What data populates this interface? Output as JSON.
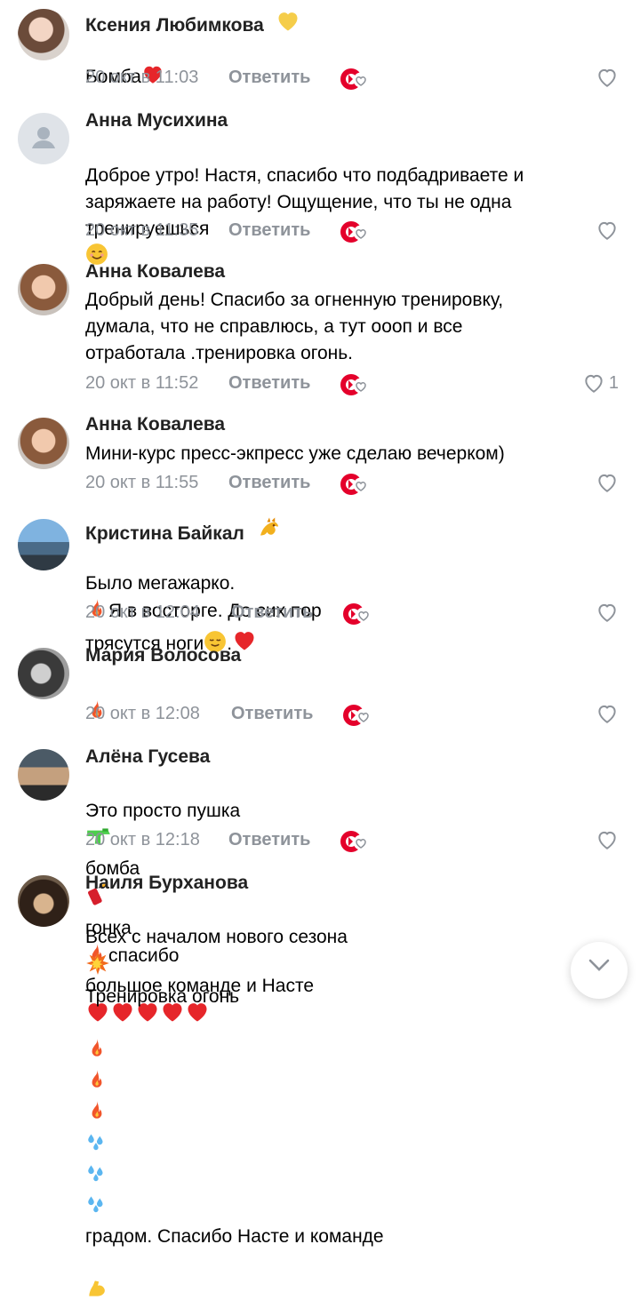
{
  "reply_label": "Ответить",
  "comments": [
    {
      "name": "Ксения Любимкова",
      "text": "Бомба",
      "time": "20 окт в 11:03"
    },
    {
      "name": "Анна Мусихина",
      "text": "Доброе утро! Настя, спасибо что подбадриваете и\nзаряжаете на работу! Ощущение, что ты не одна\nтренируешься",
      "time": "20 окт в 11:35"
    },
    {
      "name": "Анна Ковалева",
      "text": "Добрый день! Спасибо за огненную тренировку,\nдумала, что не справлюсь, а тут оооп и все\nотработала .тренировка огонь.",
      "time": "20 окт в 11:52",
      "likes": "1"
    },
    {
      "name": "Анна Ковалева",
      "text": "Мини-курс пресс-экпресс уже сделаю вечерком)",
      "time": "20 окт в 11:55"
    },
    {
      "name": "Кристина Байкал",
      "text_a": "Было мегажарко.",
      "text_b": "Я в восторге. До сих пор",
      "text_c": "трясутся ноги",
      "text_d": ".",
      "time": "20 окт в 12:04"
    },
    {
      "name": "Мария Волосова",
      "time": "20 окт в 12:08"
    },
    {
      "name": "Алёна Гусева",
      "text_a": "Это просто пушка",
      "text_b": "бомба",
      "text_c": "гонка",
      "text_d": "спасибо",
      "text_e": "большое команде и Насте",
      "time": "20 окт в 12:18"
    },
    {
      "name": "Наиля Бурханова",
      "text_a": "Всех с началом нового сезона",
      "text_b": "Тренировка огонь",
      "text_c": "градом. Спасибо Насте и команде"
    }
  ],
  "colors": {
    "meta": "#8e939a",
    "accent": "#e4002b",
    "heart": "#e6262a",
    "badge_gold": "#f5cd4a"
  }
}
